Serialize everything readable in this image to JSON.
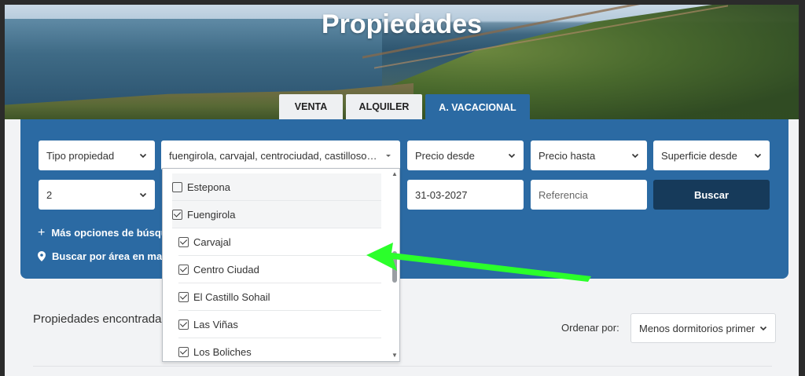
{
  "hero": {
    "title": "Propiedades"
  },
  "tabs": [
    {
      "label": "VENTA",
      "active": false
    },
    {
      "label": "ALQUILER",
      "active": false
    },
    {
      "label": "A. VACACIONAL",
      "active": true
    }
  ],
  "filters": {
    "tipo_propiedad": "Tipo propiedad",
    "zonas": "fuengirola, carvajal, centrociudad, castillosohai...",
    "precio_desde": "Precio desde",
    "precio_hasta": "Precio hasta",
    "superficie_desde": "Superficie desde",
    "dormitorios": "2",
    "fecha": "31-03-2027",
    "referencia_placeholder": "Referencia",
    "buscar_label": "Buscar",
    "mas_opciones": "Más opciones de búsque",
    "buscar_mapa": "Buscar por área en mapa"
  },
  "zone_dropdown": {
    "items": [
      {
        "label": "Estepona",
        "checked": false,
        "level": "parent"
      },
      {
        "label": "Fuengirola",
        "checked": true,
        "level": "parent"
      },
      {
        "label": "Carvajal",
        "checked": true,
        "level": "child"
      },
      {
        "label": "Centro Ciudad",
        "checked": true,
        "level": "child"
      },
      {
        "label": "El Castillo Sohail",
        "checked": true,
        "level": "child"
      },
      {
        "label": "Las Viñas",
        "checked": true,
        "level": "child"
      },
      {
        "label": "Los Boliches",
        "checked": true,
        "level": "child"
      }
    ]
  },
  "results": {
    "found_label": "Propiedades encontradas",
    "sort_label": "Ordenar por:",
    "sort_value": "Menos dormitorios primer"
  },
  "colors": {
    "panel": "#2b6aa3",
    "button_dark": "#163a5a",
    "annotation_arrow": "#2bff2b"
  }
}
